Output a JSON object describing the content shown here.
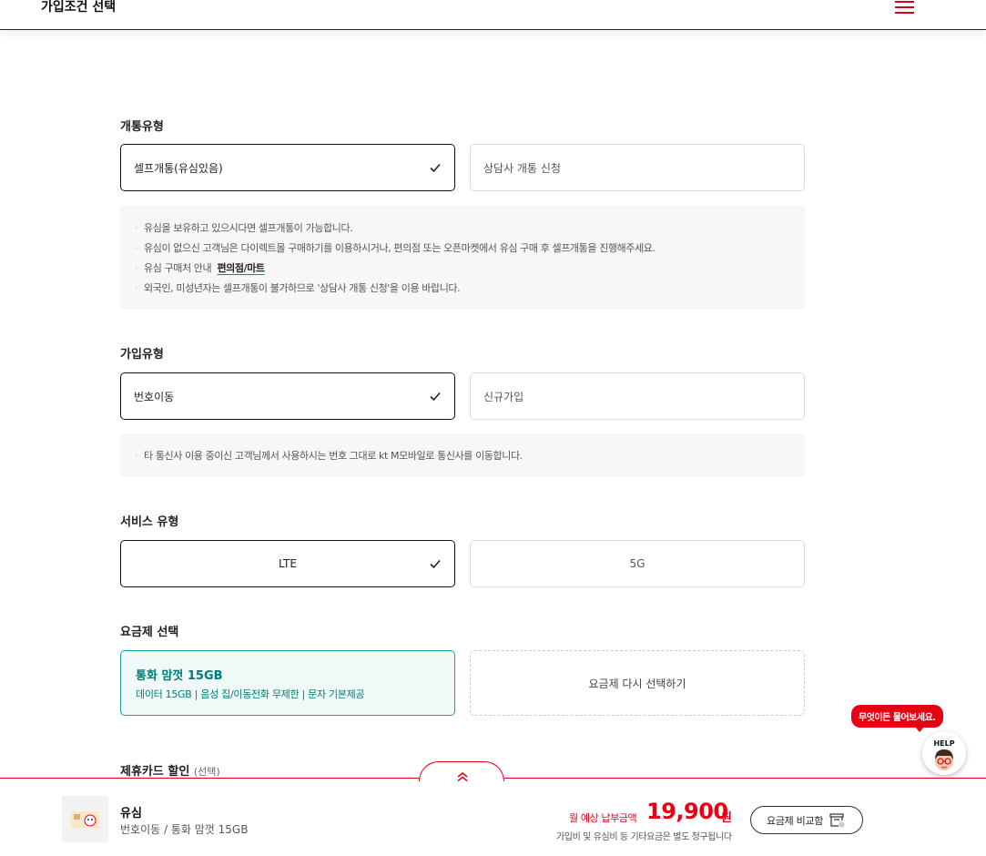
{
  "header": {
    "title": "가입조건 선택",
    "menu_icon": "hamburger-menu-icon"
  },
  "activation": {
    "label": "개통유형",
    "options": [
      "셀프개통(유심있음)",
      "상담사 개통 신청"
    ],
    "selected": "셀프개통(유심있음)",
    "notices": [
      "유심을 보유하고 있으시다면 셀프개통이 가능합니다.",
      "유심이 없으신 고객님은 다이렉트몰 구매하기를 이용하시거나, 편의점 또는 오픈마켓에서 유심 구매 후 셀프개통을 진행해주세요."
    ],
    "notice_guide_prefix": "유심 구매처 안내",
    "notice_guide_link": "편의점/마트",
    "notice_last": "외국인, 미성년자는 셀프개통이 불가하므로 '상담사 개통 신청'을 이용 바랍니다."
  },
  "join": {
    "label": "가입유형",
    "options": [
      "번호이동",
      "신규가입"
    ],
    "selected": "번호이동",
    "notice": "타 통신사 이용 중이신 고객님께서 사용하시는 번호 그대로 kt M모바일로 통신사를 이동합니다."
  },
  "service": {
    "label": "서비스 유형",
    "options": [
      "LTE",
      "5G"
    ],
    "selected": "LTE"
  },
  "plan": {
    "label": "요금제 선택",
    "name": "통화 맘껏 15GB",
    "desc": "데이터 15GB | 음성 집/이동전화 무제한 | 문자 기본제공",
    "reselect_label": "요금제 다시 선택하기"
  },
  "card": {
    "label": "제휴카드 할인",
    "optional": "(선택)"
  },
  "help": {
    "bubble": "무엇이든 물어보세요.",
    "button": "HELP"
  },
  "bottom": {
    "product_name": "유심",
    "product_sub": "번호이동 / 통화 맘껏 15GB",
    "price_label": "월 예상 납부금액",
    "price_value": "19,900",
    "price_unit": "원",
    "price_note": "가입비 및 유심비 등 기타요금은 별도 청구됩니다",
    "compare_label": "요금제 비교함"
  },
  "colors": {
    "accent": "#e60012",
    "teal": "#007a78"
  }
}
